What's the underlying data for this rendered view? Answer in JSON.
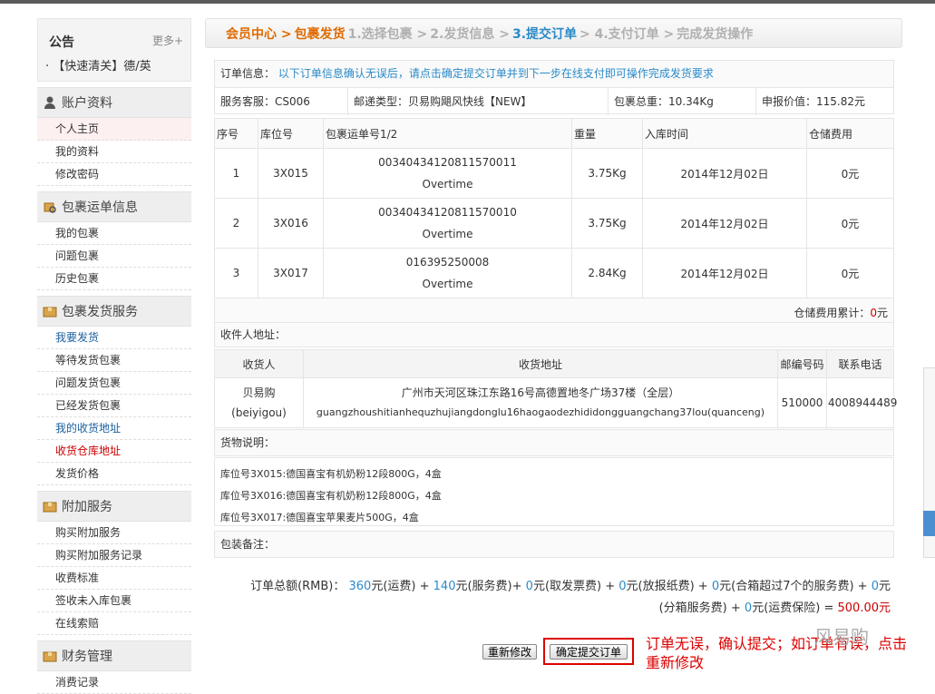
{
  "sidebar": {
    "notice_title": "公告",
    "notice_more": "更多+",
    "notice_line": "· 【快速清关】德/英",
    "sections": [
      {
        "title": "账户资料",
        "items": [
          "个人主页",
          "我的资料",
          "修改密码"
        ]
      },
      {
        "title": "包裹运单信息",
        "items": [
          "我的包裹",
          "问题包裹",
          "历史包裹"
        ]
      },
      {
        "title": "包裹发货服务",
        "items": [
          "我要发货",
          "等待发货包裹",
          "问题发货包裹",
          "已经发货包裹",
          "我的收货地址",
          "收货仓库地址",
          "发货价格"
        ]
      },
      {
        "title": "附加服务",
        "items": [
          "购买附加服务",
          "购买附加服务记录",
          "收费标准",
          "签收未入库包裹",
          "在线索赔"
        ]
      },
      {
        "title": "财务管理",
        "items": [
          "消费记录"
        ]
      }
    ]
  },
  "crumb": {
    "home": "会员中心 >",
    "current": "包裹发货",
    "step1": "1.选择包裹 >",
    "step2": "2.发货信息 >",
    "step3": "3.提交订单",
    "step4": "> 4.支付订单 >",
    "step5": "完成发货操作"
  },
  "order": {
    "label": "订单信息：",
    "hint": "以下订单信息确认无误后，请点击确定提交订单并到下一步在线支付即可操作完成发货要求",
    "service": "服务客服：CS006",
    "mail_type": "邮递类型：贝易购飓风快线【NEW】",
    "weight": "包裹总重：10.34Kg",
    "declared": "申报价值：115.82元"
  },
  "packages": {
    "headers": [
      "序号",
      "库位号",
      "包裹运单号1/2",
      "重量",
      "入库时间",
      "仓储费用"
    ],
    "rows": [
      {
        "no": "1",
        "loc": "3X015",
        "tracking": "00340434120811570011",
        "sub": "Overtime",
        "weight": "3.75Kg",
        "date": "2014年12月02日",
        "fee": "0元"
      },
      {
        "no": "2",
        "loc": "3X016",
        "tracking": "00340434120811570010",
        "sub": "Overtime",
        "weight": "3.75Kg",
        "date": "2014年12月02日",
        "fee": "0元"
      },
      {
        "no": "3",
        "loc": "3X017",
        "tracking": "016395250008",
        "sub": "Overtime",
        "weight": "2.84Kg",
        "date": "2014年12月02日",
        "fee": "0元"
      }
    ],
    "total_label": "仓储费用累计：",
    "total_value": "0",
    "total_unit": "元"
  },
  "recipient": {
    "label": "收件人地址：",
    "headers": [
      "收货人",
      "收货地址",
      "邮编号码",
      "联系电话"
    ],
    "name": "贝易购(beiyigou)",
    "address_cn": "广州市天河区珠江东路16号高德置地冬广场37楼（全层）",
    "address_py": "guangzhoushitianhequzhujiangdonglu16haogaodezhididongguangchang37lou(quanceng)",
    "zip": "510000",
    "phone": "4008944489"
  },
  "goods": {
    "label": "货物说明：",
    "lines": [
      "库位号3X015:德国喜宝有机奶粉12段800G，4盒",
      "库位号3X016:德国喜宝有机奶粉12段800G，4盒",
      "库位号3X017:德国喜宝苹果麦片500G，4盒"
    ]
  },
  "remark_label": "包装备注：",
  "total": {
    "prefix": "订单总额(RMB)：",
    "freight": "360",
    "freight_t": "元(运费) + ",
    "service": "140",
    "service_t": "元(服务费)+ ",
    "invoice": "0",
    "invoice_t": "元(取发票费) + ",
    "paper": "0",
    "paper_t": "元(放报纸费) + ",
    "merge": "0",
    "merge_t": "元(合箱超过7个的服务费) + ",
    "split": "0",
    "split_t": "元",
    "line2a": "(分箱服务费) + ",
    "ins": "0",
    "ins_t": "元(运费保险) = ",
    "sum": "500.00元"
  },
  "buttons": {
    "redo": "重新修改",
    "submit": "确定提交订单"
  },
  "annotation": "订单无误，确认提交；如订单有误，点击重新修改",
  "watermark": "风易购"
}
